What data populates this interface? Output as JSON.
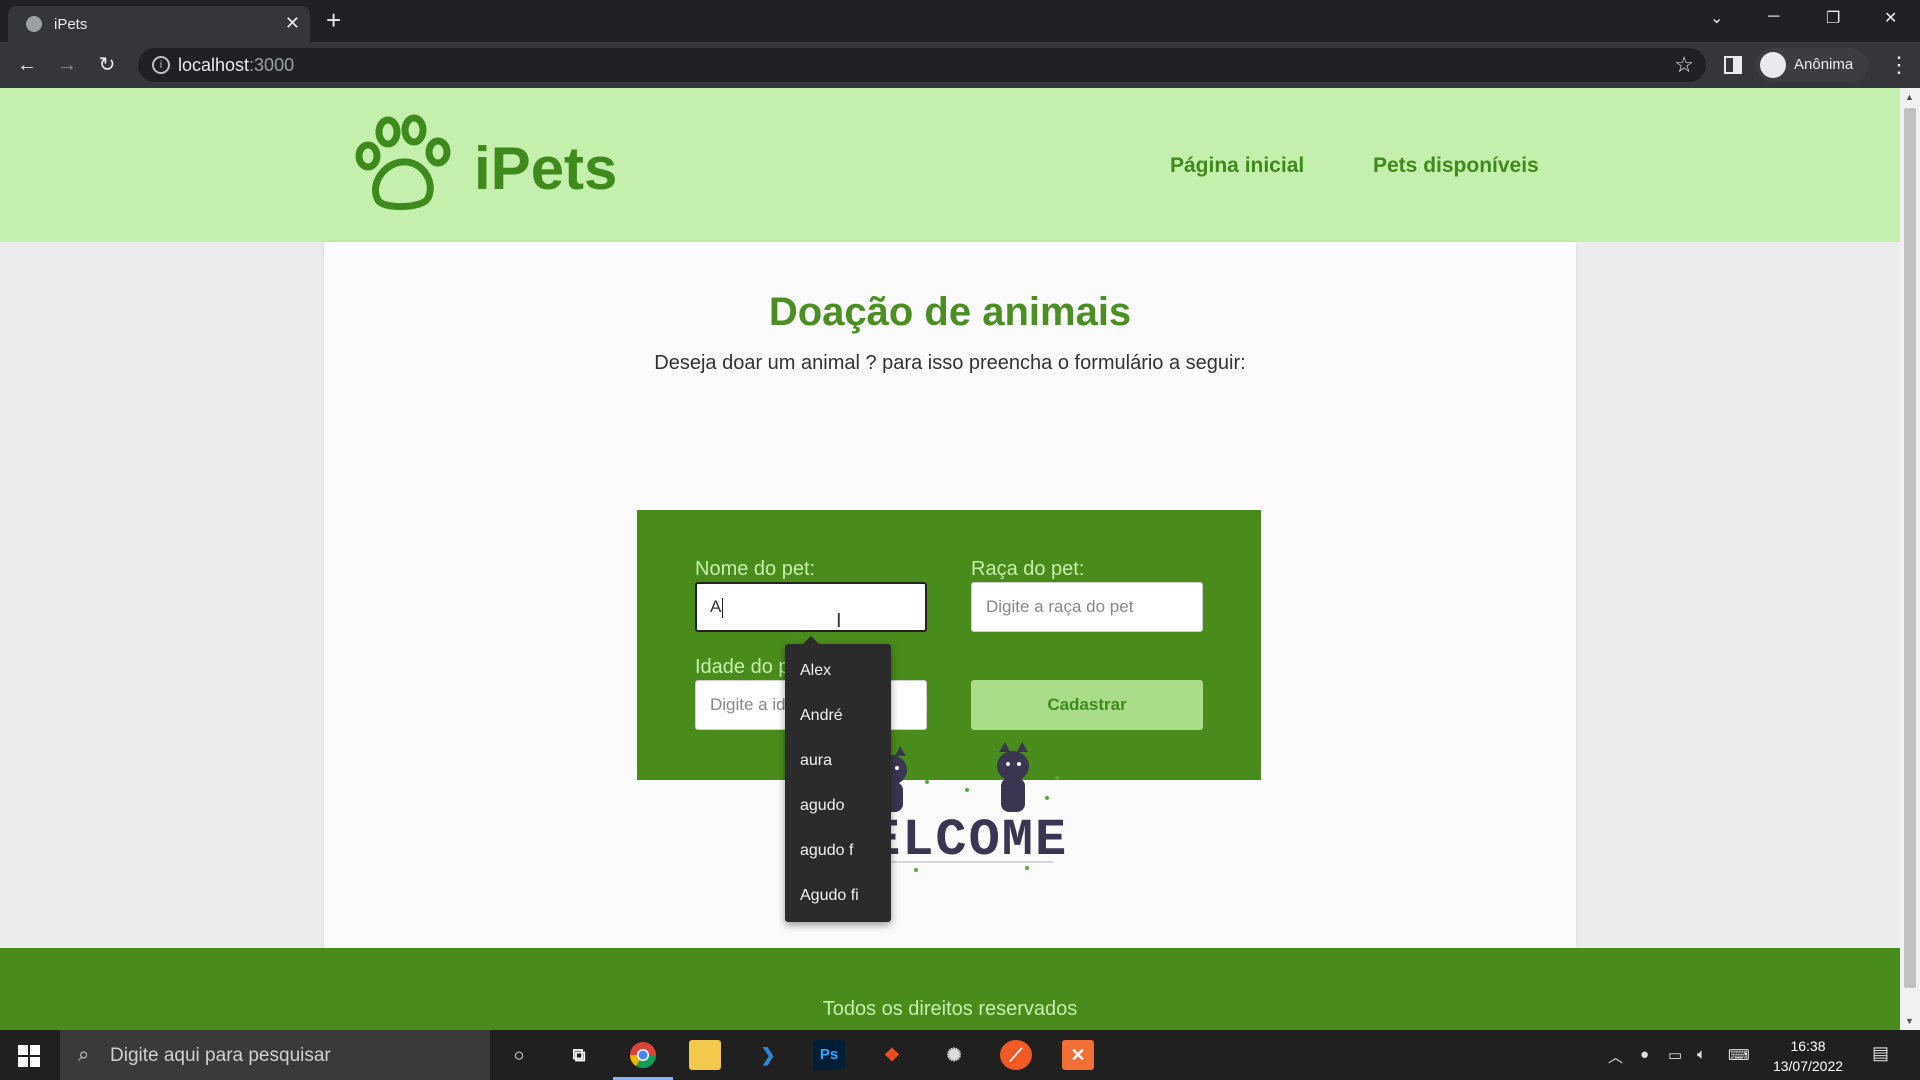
{
  "browser": {
    "tab_title": "iPets",
    "tab_close": "✕",
    "new_tab": "+",
    "url_host": "localhost",
    "url_port": ":3000",
    "profile_name": "Anônima"
  },
  "site": {
    "brand": "iPets",
    "nav": [
      "Página inicial",
      "Pets disponíveis"
    ],
    "title": "Doação de animais",
    "subtitle": "Deseja doar um animal ? para isso preencha o formulário a seguir:",
    "form": {
      "name_label": "Nome do pet:",
      "name_value": "A",
      "breed_label": "Raça do pet:",
      "breed_placeholder": "Digite a raça do pet",
      "age_label": "Idade do p",
      "age_placeholder": "Digite a id",
      "submit_label": "Cadastrar"
    },
    "autocomplete": [
      "Alex",
      "André",
      "aura",
      "agudo",
      "agudo f",
      "Agudo fi"
    ],
    "welcome_text": "WELCOME",
    "footer": "Todos os direitos reservados"
  },
  "taskbar": {
    "search_placeholder": "Digite aqui para pesquisar",
    "time": "16:38",
    "date": "13/07/2022"
  },
  "colors": {
    "header_bg": "#c5efac",
    "primary_green": "#4a8c1c",
    "title_green": "#4b8f22",
    "button_bg": "#a9dd8a"
  }
}
